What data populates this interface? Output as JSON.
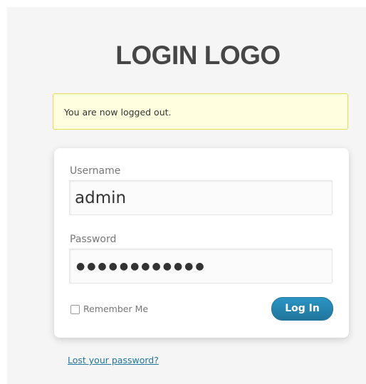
{
  "logo": {
    "text": "LOGIN LOGO"
  },
  "message": {
    "text": "You are now logged out."
  },
  "form": {
    "username_label": "Username",
    "username_value": "admin",
    "password_label": "Password",
    "password_value": "●●●●●●●●●●●●",
    "remember_label": "Remember Me",
    "remember_checked": false,
    "submit_label": "Log In"
  },
  "links": {
    "lost_password": "Lost your password?"
  },
  "colors": {
    "accent": "#21759b",
    "message_background": "#ffffe0",
    "message_border": "#e6db55",
    "page_background": "#f5f5f5"
  }
}
